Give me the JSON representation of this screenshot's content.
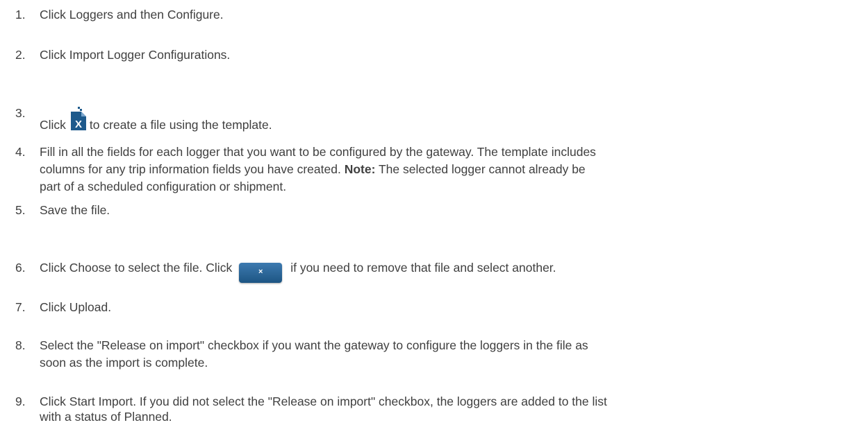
{
  "steps": [
    {
      "num": "1.",
      "text": "Click Loggers and then Configure."
    },
    {
      "num": "2.",
      "text": "Click Import Logger Configurations."
    },
    {
      "num": "3.",
      "before": "Click",
      "icon": "excel-file-icon",
      "after": "to create a file using the template."
    },
    {
      "num": "4.",
      "line1": "Fill in all the fields for each logger that you want to be configured by the gateway. The template includes",
      "line2_a": "columns for any trip information fields you have created. ",
      "note_label": "Note:",
      "line2_b": " The selected logger cannot already be",
      "line3": "part of a scheduled configuration or shipment."
    },
    {
      "num": "5.",
      "text": "Save the file."
    },
    {
      "num": "6.",
      "before": "Click Choose to select the file. Click",
      "icon": "remove-file-button-icon",
      "icon_glyph": "×",
      "after": "if you need to remove that file and select another."
    },
    {
      "num": "7.",
      "text": "Click Upload."
    },
    {
      "num": "8.",
      "line1": "Select the \"Release on import\" checkbox if you want the gateway to configure the loggers in the file as",
      "line2": "soon as the import is complete."
    },
    {
      "num": "9.",
      "line1": "Click Start Import. If you did not select the \"Release on import\" checkbox, the loggers are added to the list",
      "line2": "with a status of Planned."
    }
  ],
  "colors": {
    "text": "#404040",
    "excel_icon": "#1e5a8c",
    "remove_button": "#2b6699"
  }
}
